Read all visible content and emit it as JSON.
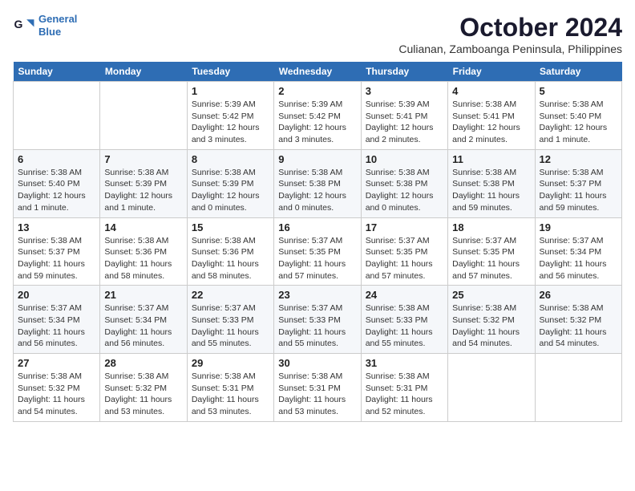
{
  "logo": {
    "line1": "General",
    "line2": "Blue"
  },
  "title": "October 2024",
  "location": "Culianan, Zamboanga Peninsula, Philippines",
  "weekdays": [
    "Sunday",
    "Monday",
    "Tuesday",
    "Wednesday",
    "Thursday",
    "Friday",
    "Saturday"
  ],
  "weeks": [
    [
      {
        "day": "",
        "info": ""
      },
      {
        "day": "",
        "info": ""
      },
      {
        "day": "1",
        "info": "Sunrise: 5:39 AM\nSunset: 5:42 PM\nDaylight: 12 hours\nand 3 minutes."
      },
      {
        "day": "2",
        "info": "Sunrise: 5:39 AM\nSunset: 5:42 PM\nDaylight: 12 hours\nand 3 minutes."
      },
      {
        "day": "3",
        "info": "Sunrise: 5:39 AM\nSunset: 5:41 PM\nDaylight: 12 hours\nand 2 minutes."
      },
      {
        "day": "4",
        "info": "Sunrise: 5:38 AM\nSunset: 5:41 PM\nDaylight: 12 hours\nand 2 minutes."
      },
      {
        "day": "5",
        "info": "Sunrise: 5:38 AM\nSunset: 5:40 PM\nDaylight: 12 hours\nand 1 minute."
      }
    ],
    [
      {
        "day": "6",
        "info": "Sunrise: 5:38 AM\nSunset: 5:40 PM\nDaylight: 12 hours\nand 1 minute."
      },
      {
        "day": "7",
        "info": "Sunrise: 5:38 AM\nSunset: 5:39 PM\nDaylight: 12 hours\nand 1 minute."
      },
      {
        "day": "8",
        "info": "Sunrise: 5:38 AM\nSunset: 5:39 PM\nDaylight: 12 hours\nand 0 minutes."
      },
      {
        "day": "9",
        "info": "Sunrise: 5:38 AM\nSunset: 5:38 PM\nDaylight: 12 hours\nand 0 minutes."
      },
      {
        "day": "10",
        "info": "Sunrise: 5:38 AM\nSunset: 5:38 PM\nDaylight: 12 hours\nand 0 minutes."
      },
      {
        "day": "11",
        "info": "Sunrise: 5:38 AM\nSunset: 5:38 PM\nDaylight: 11 hours\nand 59 minutes."
      },
      {
        "day": "12",
        "info": "Sunrise: 5:38 AM\nSunset: 5:37 PM\nDaylight: 11 hours\nand 59 minutes."
      }
    ],
    [
      {
        "day": "13",
        "info": "Sunrise: 5:38 AM\nSunset: 5:37 PM\nDaylight: 11 hours\nand 59 minutes."
      },
      {
        "day": "14",
        "info": "Sunrise: 5:38 AM\nSunset: 5:36 PM\nDaylight: 11 hours\nand 58 minutes."
      },
      {
        "day": "15",
        "info": "Sunrise: 5:38 AM\nSunset: 5:36 PM\nDaylight: 11 hours\nand 58 minutes."
      },
      {
        "day": "16",
        "info": "Sunrise: 5:37 AM\nSunset: 5:35 PM\nDaylight: 11 hours\nand 57 minutes."
      },
      {
        "day": "17",
        "info": "Sunrise: 5:37 AM\nSunset: 5:35 PM\nDaylight: 11 hours\nand 57 minutes."
      },
      {
        "day": "18",
        "info": "Sunrise: 5:37 AM\nSunset: 5:35 PM\nDaylight: 11 hours\nand 57 minutes."
      },
      {
        "day": "19",
        "info": "Sunrise: 5:37 AM\nSunset: 5:34 PM\nDaylight: 11 hours\nand 56 minutes."
      }
    ],
    [
      {
        "day": "20",
        "info": "Sunrise: 5:37 AM\nSunset: 5:34 PM\nDaylight: 11 hours\nand 56 minutes."
      },
      {
        "day": "21",
        "info": "Sunrise: 5:37 AM\nSunset: 5:34 PM\nDaylight: 11 hours\nand 56 minutes."
      },
      {
        "day": "22",
        "info": "Sunrise: 5:37 AM\nSunset: 5:33 PM\nDaylight: 11 hours\nand 55 minutes."
      },
      {
        "day": "23",
        "info": "Sunrise: 5:37 AM\nSunset: 5:33 PM\nDaylight: 11 hours\nand 55 minutes."
      },
      {
        "day": "24",
        "info": "Sunrise: 5:38 AM\nSunset: 5:33 PM\nDaylight: 11 hours\nand 55 minutes."
      },
      {
        "day": "25",
        "info": "Sunrise: 5:38 AM\nSunset: 5:32 PM\nDaylight: 11 hours\nand 54 minutes."
      },
      {
        "day": "26",
        "info": "Sunrise: 5:38 AM\nSunset: 5:32 PM\nDaylight: 11 hours\nand 54 minutes."
      }
    ],
    [
      {
        "day": "27",
        "info": "Sunrise: 5:38 AM\nSunset: 5:32 PM\nDaylight: 11 hours\nand 54 minutes."
      },
      {
        "day": "28",
        "info": "Sunrise: 5:38 AM\nSunset: 5:32 PM\nDaylight: 11 hours\nand 53 minutes."
      },
      {
        "day": "29",
        "info": "Sunrise: 5:38 AM\nSunset: 5:31 PM\nDaylight: 11 hours\nand 53 minutes."
      },
      {
        "day": "30",
        "info": "Sunrise: 5:38 AM\nSunset: 5:31 PM\nDaylight: 11 hours\nand 53 minutes."
      },
      {
        "day": "31",
        "info": "Sunrise: 5:38 AM\nSunset: 5:31 PM\nDaylight: 11 hours\nand 52 minutes."
      },
      {
        "day": "",
        "info": ""
      },
      {
        "day": "",
        "info": ""
      }
    ]
  ]
}
